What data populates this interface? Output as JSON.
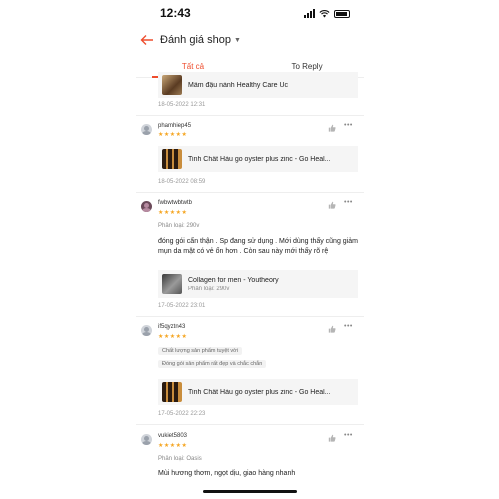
{
  "status_bar": {
    "time": "12:43"
  },
  "header": {
    "title": "Đánh giá shop"
  },
  "tabs": [
    {
      "label": "Tất cả",
      "active": true
    },
    {
      "label": "To Reply",
      "active": false
    }
  ],
  "reviews": [
    {
      "product": "Mầm đậu nành Healthy Care Úc",
      "date": "18-05-2022 12:31"
    },
    {
      "username": "phamhiep45",
      "rating": 5,
      "product": "Tinh Chất Hàu go oyster plus zinc - Go Heal...",
      "date": "18-05-2022 08:59"
    },
    {
      "username": "fwbwtwbtwtb",
      "rating": 5,
      "variant": "Phân loại: 290v",
      "comment": "đóng gói cẩn thận . Sp đang sử dụng . Mới dùng thấy cũng giảm mụn da mặt có vẻ ổn hơn . Còn sau này mới thấy rõ rệ",
      "product": "Collagen for men - Youtheory",
      "product_variant": "Phân loại: 290v",
      "date": "17-05-2022 23:01"
    },
    {
      "username": "if5qyztn43",
      "rating": 5,
      "tags": [
        "Chất lượng sản phẩm tuyệt vời",
        "Đóng gói sản phẩm rất đẹp và chắc chắn"
      ],
      "product": "Tinh Chất Hàu go oyster plus zinc - Go Heal...",
      "date": "17-05-2022 22:23"
    },
    {
      "username": "vukiet5803",
      "rating": 5,
      "variant": "Phân loại: Oasis",
      "comment": "Mùi hương thơm, ngọt dịu, giao hàng nhanh"
    }
  ],
  "stars_text": "★★★★★",
  "accent_color": "#ee4d2d",
  "star_color": "#f5a623",
  "icons": [
    "back-arrow-icon",
    "chevron-down-icon",
    "like-icon",
    "more-icon",
    "avatar-icon"
  ]
}
